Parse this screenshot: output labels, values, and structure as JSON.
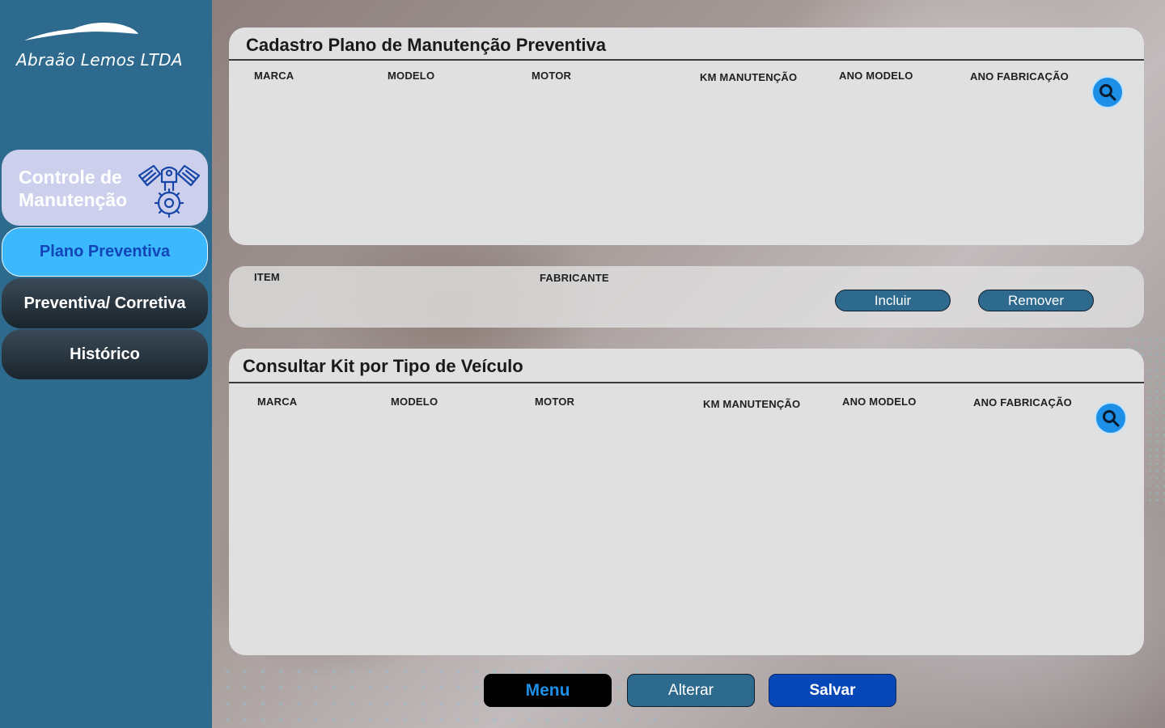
{
  "sidebar": {
    "brand": "Abraão Lemos LTDA",
    "module_title": "Controle de Manutenção",
    "nav": {
      "plano": "Plano Preventiva",
      "preventiva_corretiva": "Preventiva/ Corretiva",
      "historico": "Histórico"
    },
    "icons": {
      "logo": "car-silhouette-icon",
      "module": "engine-gear-icon"
    }
  },
  "cadastro": {
    "title": "Cadastro Plano de Manutenção Preventiva",
    "columns": [
      "MARCA",
      "MODELO",
      "MOTOR",
      "KM MANUTENÇÃO",
      "ANO MODELO",
      "ANO FABRICAÇÃO"
    ],
    "search_icon": "search-icon"
  },
  "itens": {
    "columns": [
      "ITEM",
      "FABRICANTE"
    ],
    "incluir_label": "Incluir",
    "remover_label": "Remover"
  },
  "consulta": {
    "title": "Consultar Kit por Tipo de Veículo",
    "columns": [
      "MARCA",
      "MODELO",
      "MOTOR",
      "KM MANUTENÇÃO",
      "ANO MODELO",
      "ANO FABRICAÇÃO"
    ],
    "search_icon": "search-icon"
  },
  "footer": {
    "menu_label": "Menu",
    "alterar_label": "Alterar",
    "salvar_label": "Salvar"
  },
  "colors": {
    "sidebar": "#2e6a8e",
    "active_nav": "#3cb8ff",
    "panel": "#e0e0e0",
    "search_button": "#1e8fe6",
    "salvar": "#0847b8"
  }
}
